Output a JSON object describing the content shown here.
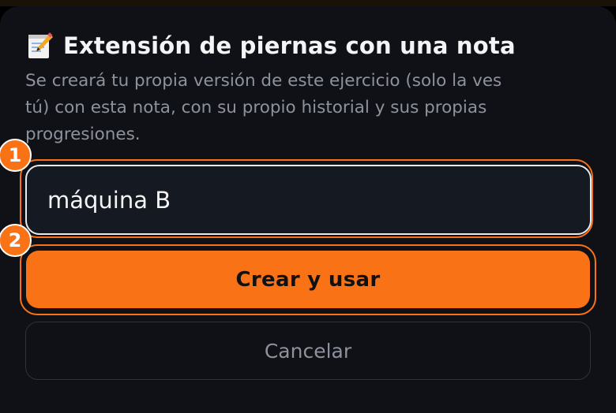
{
  "dialog": {
    "title_icon": "memo-icon",
    "title": "Extensión de piernas con una nota",
    "description": "Se creará tu propia versión de este ejercicio (solo la ves\ntú) con esta nota, con su propio historial y sus propias\nprogresiones.",
    "note_input": {
      "value": "máquina B"
    },
    "primary_button": "Crear y usar",
    "cancel_button": "Cancelar"
  },
  "badges": {
    "input": "1",
    "primary": "2"
  },
  "colors": {
    "accent": "#f97316",
    "background": "#0f1116",
    "input_background": "#141922",
    "muted_text": "#8d929c"
  }
}
